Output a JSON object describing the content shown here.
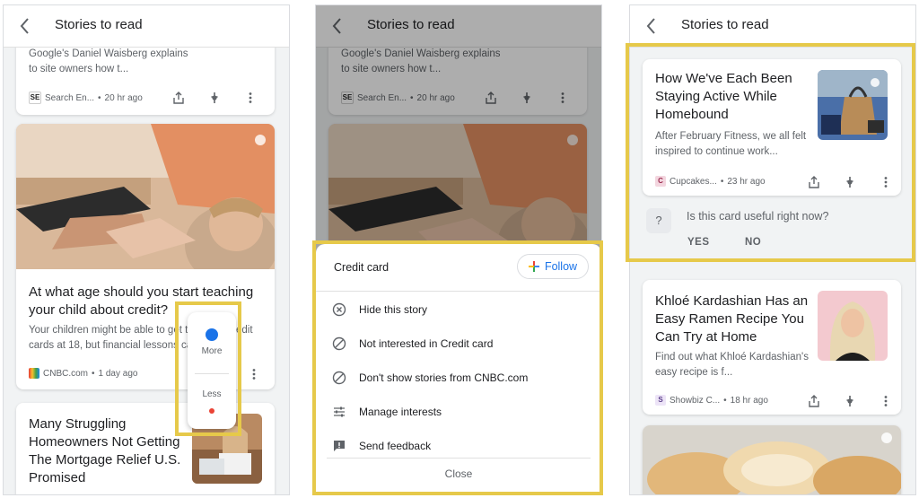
{
  "header_title": "Stories to read",
  "screen1": {
    "card_top": {
      "snippet": "Google's Daniel Waisberg explains to site owners how t...",
      "source": "Search En...",
      "time": "20 hr ago"
    },
    "card_credit": {
      "headline": "At what age should you start teaching your child about credit?",
      "snippet": "Your children might be able to get their first credit cards at 18, but financial lessons can s...",
      "source": "CNBC.com",
      "time": "1 day ago"
    },
    "card_mortgage": {
      "headline": "Many Struggling Homeowners Not Getting The Mortgage Relief U.S. Promised"
    },
    "popover": {
      "more_label": "More",
      "less_label": "Less"
    }
  },
  "screen2": {
    "sheet_title": "Credit card",
    "follow_label": "Follow",
    "menu": [
      "Hide this story",
      "Not interested in Credit card",
      "Don't show stories from CNBC.com",
      "Manage interests",
      "Send feedback"
    ],
    "close_label": "Close"
  },
  "screen3": {
    "card_homebound": {
      "headline": "How We've Each Been Staying Active While Homebound",
      "snippet": "After February Fitness, we all felt inspired to continue work...",
      "source": "Cupcakes...",
      "time": "23 hr ago"
    },
    "survey": {
      "question": "Is this card useful right now?",
      "yes_label": "YES",
      "no_label": "NO"
    },
    "card_khloe": {
      "headline": "Khloé Kardashian Has an Easy Ramen Recipe You Can Try at Home",
      "snippet": "Find out what Khloé Kardashian's easy recipe is f...",
      "source": "Showbiz C...",
      "time": "18 hr ago"
    }
  },
  "colors": {
    "highlight": "#e6c94a",
    "accent_blue": "#1a73e8",
    "more_dot": "#1a73e8",
    "less_dot": "#ea4335"
  },
  "icons": [
    "back-arrow-icon",
    "share-icon",
    "interest-icon",
    "more-vert-icon",
    "plus-icon",
    "hide-icon",
    "block-icon",
    "tune-icon",
    "feedback-icon",
    "question-icon"
  ]
}
